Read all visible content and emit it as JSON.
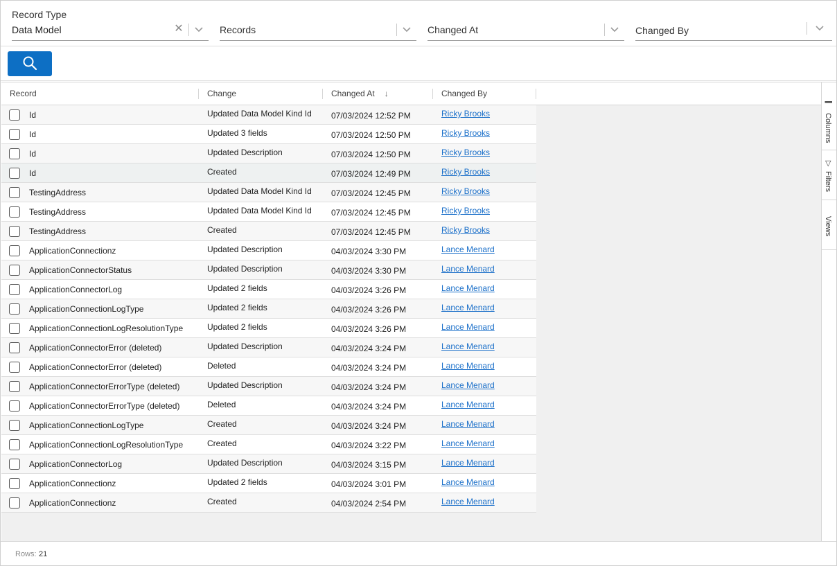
{
  "filters": {
    "record_type": {
      "label": "Record Type",
      "value": "Data Model"
    },
    "records": {
      "placeholder": "Records"
    },
    "changed_at": {
      "placeholder": "Changed At"
    },
    "changed_by": {
      "placeholder": "Changed By"
    }
  },
  "search_button": {
    "icon": "search-icon"
  },
  "grid": {
    "columns": [
      "Record",
      "Change",
      "Changed At",
      "Changed By"
    ],
    "sort": {
      "column": "Changed At",
      "direction": "descending",
      "indicator": "↓"
    },
    "rows": [
      {
        "record": "Id",
        "change": "Updated Data Model Kind Id",
        "changed_at": "07/03/2024 12:52 PM",
        "changed_by": "Ricky Brooks"
      },
      {
        "record": "Id",
        "change": "Updated 3 fields",
        "changed_at": "07/03/2024 12:50 PM",
        "changed_by": "Ricky Brooks"
      },
      {
        "record": "Id",
        "change": "Updated Description",
        "changed_at": "07/03/2024 12:50 PM",
        "changed_by": "Ricky Brooks"
      },
      {
        "record": "Id",
        "change": "Created",
        "changed_at": "07/03/2024 12:49 PM",
        "changed_by": "Ricky Brooks"
      },
      {
        "record": "TestingAddress",
        "change": "Updated Data Model Kind Id",
        "changed_at": "07/03/2024 12:45 PM",
        "changed_by": "Ricky Brooks"
      },
      {
        "record": "TestingAddress",
        "change": "Updated Data Model Kind Id",
        "changed_at": "07/03/2024 12:45 PM",
        "changed_by": "Ricky Brooks"
      },
      {
        "record": "TestingAddress",
        "change": "Created",
        "changed_at": "07/03/2024 12:45 PM",
        "changed_by": "Ricky Brooks"
      },
      {
        "record": "ApplicationConnectionz",
        "change": "Updated Description",
        "changed_at": "04/03/2024 3:30 PM",
        "changed_by": "Lance Menard"
      },
      {
        "record": "ApplicationConnectorStatus",
        "change": "Updated Description",
        "changed_at": "04/03/2024 3:30 PM",
        "changed_by": "Lance Menard"
      },
      {
        "record": "ApplicationConnectorLog",
        "change": "Updated 2 fields",
        "changed_at": "04/03/2024 3:26 PM",
        "changed_by": "Lance Menard"
      },
      {
        "record": "ApplicationConnectionLogType",
        "change": "Updated 2 fields",
        "changed_at": "04/03/2024 3:26 PM",
        "changed_by": "Lance Menard"
      },
      {
        "record": "ApplicationConnectionLogResolutionType",
        "change": "Updated 2 fields",
        "changed_at": "04/03/2024 3:26 PM",
        "changed_by": "Lance Menard"
      },
      {
        "record": "ApplicationConnectorError (deleted)",
        "change": "Updated Description",
        "changed_at": "04/03/2024 3:24 PM",
        "changed_by": "Lance Menard"
      },
      {
        "record": "ApplicationConnectorError (deleted)",
        "change": "Deleted",
        "changed_at": "04/03/2024 3:24 PM",
        "changed_by": "Lance Menard"
      },
      {
        "record": "ApplicationConnectorErrorType (deleted)",
        "change": "Updated Description",
        "changed_at": "04/03/2024 3:24 PM",
        "changed_by": "Lance Menard"
      },
      {
        "record": "ApplicationConnectorErrorType (deleted)",
        "change": "Deleted",
        "changed_at": "04/03/2024 3:24 PM",
        "changed_by": "Lance Menard"
      },
      {
        "record": "ApplicationConnectionLogType",
        "change": "Created",
        "changed_at": "04/03/2024 3:24 PM",
        "changed_by": "Lance Menard"
      },
      {
        "record": "ApplicationConnectionLogResolutionType",
        "change": "Created",
        "changed_at": "04/03/2024 3:22 PM",
        "changed_by": "Lance Menard"
      },
      {
        "record": "ApplicationConnectorLog",
        "change": "Updated Description",
        "changed_at": "04/03/2024 3:15 PM",
        "changed_by": "Lance Menard"
      },
      {
        "record": "ApplicationConnectionz",
        "change": "Updated 2 fields",
        "changed_at": "04/03/2024 3:01 PM",
        "changed_by": "Lance Menard"
      },
      {
        "record": "ApplicationConnectionz",
        "change": "Created",
        "changed_at": "04/03/2024 2:54 PM",
        "changed_by": "Lance Menard"
      }
    ]
  },
  "side_panel": {
    "tabs": [
      {
        "label": "Columns",
        "icon": "columns-icon",
        "glyph": "|||"
      },
      {
        "label": "Filters",
        "icon": "filter-icon",
        "glyph": "▽"
      },
      {
        "label": "Views",
        "icon": "",
        "glyph": ""
      }
    ]
  },
  "status": {
    "rows_label": "Rows:",
    "rows_count": "21"
  },
  "colors": {
    "accent": "#0d6fc4",
    "link": "#1a6fc9"
  }
}
